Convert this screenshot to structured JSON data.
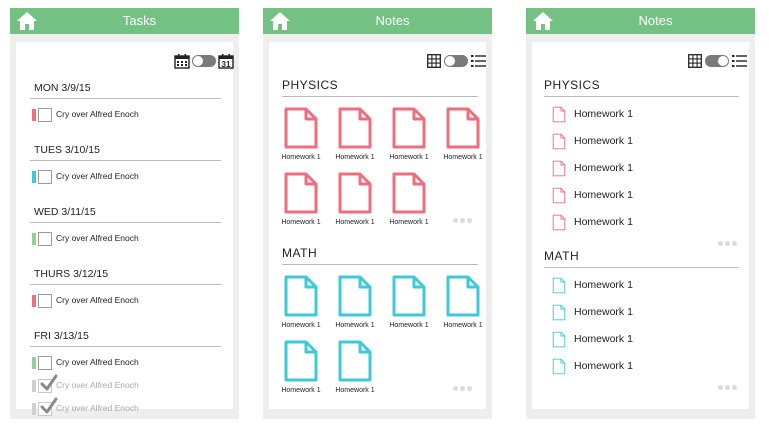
{
  "colors": {
    "header_green": "#74c283",
    "pink": "#ef6d7d",
    "teal": "#3ec9d6",
    "bar_green": "#8fd19c"
  },
  "tasks_screen": {
    "title": "Tasks",
    "days": [
      {
        "label": "MON 3/9/15",
        "items": [
          {
            "text": "Cry over Alfred Enoch",
            "color": "#ef6d7d",
            "done": false
          }
        ]
      },
      {
        "label": "TUES 3/10/15",
        "items": [
          {
            "text": "Cry over Alfred Enoch",
            "color": "#3ec9d6",
            "done": false
          }
        ]
      },
      {
        "label": "WED 3/11/15",
        "items": [
          {
            "text": "Cry over Alfred Enoch",
            "color": "#8fd19c",
            "done": false
          }
        ]
      },
      {
        "label": "THURS 3/12/15",
        "items": [
          {
            "text": "Cry over Alfred Enoch",
            "color": "#ef6d7d",
            "done": false
          }
        ]
      },
      {
        "label": "FRI 3/13/15",
        "items": [
          {
            "text": "Cry over Alfred Enoch",
            "color": "#8fd19c",
            "done": false
          },
          {
            "text": "Cry over Alfred Enoch",
            "color": "#cfcfcf",
            "done": true
          },
          {
            "text": "Cry over Alfred Enoch",
            "color": "#cfcfcf",
            "done": true
          }
        ]
      }
    ]
  },
  "notes_grid_screen": {
    "title": "Notes",
    "sections": [
      {
        "name": "PHYSICS",
        "color": "#ef6d7d",
        "files": [
          "Homework 1",
          "Homework 1",
          "Homework 1",
          "Homework 1",
          "Homework 1",
          "Homework 1",
          "Homework 1"
        ]
      },
      {
        "name": "MATH",
        "color": "#3ec9d6",
        "files": [
          "Homework 1",
          "Homework 1",
          "Homework 1",
          "Homework 1",
          "Homework 1",
          "Homework 1"
        ]
      }
    ]
  },
  "notes_list_screen": {
    "title": "Notes",
    "sections": [
      {
        "name": "PHYSICS",
        "color": "#ef6d7d",
        "files": [
          "Homework 1",
          "Homework 1",
          "Homework 1",
          "Homework 1",
          "Homework 1"
        ]
      },
      {
        "name": "MATH",
        "color": "#3ec9d6",
        "files": [
          "Homework 1",
          "Homework 1",
          "Homework 1",
          "Homework 1"
        ]
      }
    ]
  },
  "icons": {
    "home": "home-icon",
    "calendar_week": "calendar-week-icon",
    "calendar_day": "calendar-day-icon",
    "grid_view": "grid-view-icon",
    "list_view": "list-view-icon",
    "file": "file-icon",
    "more": "more-dots-icon",
    "checkmark": "checkmark-icon"
  },
  "calendar_day_number": "31"
}
